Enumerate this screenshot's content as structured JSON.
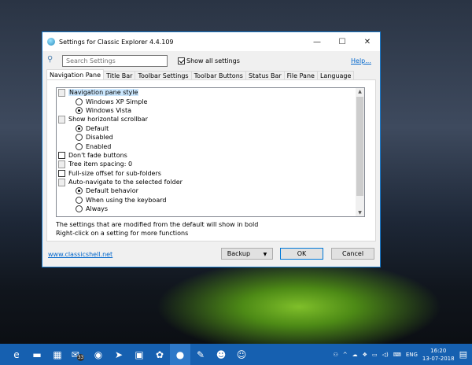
{
  "window": {
    "title": "Settings for Classic Explorer 4.4.109",
    "minimize": "—",
    "maximize": "☐",
    "close": "✕"
  },
  "search": {
    "placeholder": "Search Settings",
    "show_all_label": "Show all settings",
    "show_all_checked": true,
    "help": "Help..."
  },
  "tabs": [
    {
      "label": "Navigation Pane",
      "active": true
    },
    {
      "label": "Title Bar"
    },
    {
      "label": "Toolbar Settings"
    },
    {
      "label": "Toolbar Buttons"
    },
    {
      "label": "Status Bar"
    },
    {
      "label": "File Pane"
    },
    {
      "label": "Language"
    }
  ],
  "tree": [
    {
      "type": "group",
      "label": "Navigation pane style",
      "selected": true
    },
    {
      "type": "radio",
      "label": "Windows XP Simple",
      "checked": false
    },
    {
      "type": "radio",
      "label": "Windows Vista",
      "checked": true
    },
    {
      "type": "group",
      "label": "Show horizontal scrollbar"
    },
    {
      "type": "radio",
      "label": "Default",
      "checked": true
    },
    {
      "type": "radio",
      "label": "Disabled",
      "checked": false
    },
    {
      "type": "radio",
      "label": "Enabled",
      "checked": false
    },
    {
      "type": "check",
      "label": "Don't fade buttons",
      "checked": false
    },
    {
      "type": "group",
      "label": "Tree item spacing: 0"
    },
    {
      "type": "check",
      "label": "Full-size offset for sub-folders",
      "checked": false
    },
    {
      "type": "group",
      "label": "Auto-navigate to the selected folder"
    },
    {
      "type": "radio",
      "label": "Default behavior",
      "checked": true
    },
    {
      "type": "radio",
      "label": "When using the keyboard",
      "checked": false
    },
    {
      "type": "radio",
      "label": "Always",
      "checked": false
    }
  ],
  "hints": [
    "The settings that are modified from the default will show in bold",
    "Right-click on a setting for more functions"
  ],
  "footer": {
    "link": "www.classicshell.net",
    "backup": "Backup",
    "ok": "OK",
    "cancel": "Cancel"
  },
  "taskbar": {
    "apps": [
      "edge",
      "file-explorer",
      "store",
      "mail",
      "chrome",
      "telegram",
      "trello",
      "settings",
      "classic-shell",
      "paint",
      "contact-1",
      "contact-2"
    ],
    "mail_badge": "33",
    "language": "ENG",
    "time": "16:20",
    "date": "13-07-2018"
  }
}
